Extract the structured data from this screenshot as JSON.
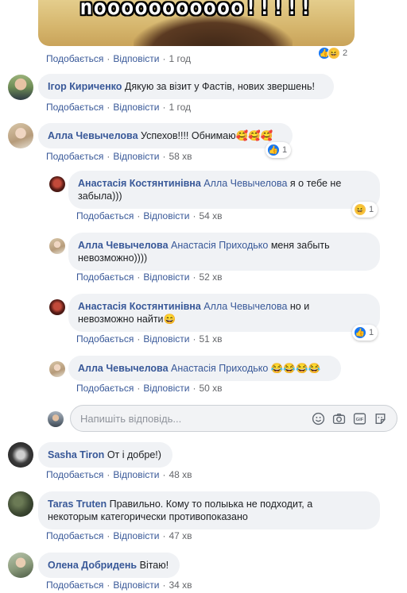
{
  "media": {
    "caption": "nooooooooooo!!!!!"
  },
  "labels": {
    "like": "Подобається",
    "reply": "Відповісти",
    "sep": "·"
  },
  "comments": [
    {
      "time": "1 год",
      "reaction_count": "2"
    },
    {
      "author": "Ігор Кириченко",
      "text": "Дякую за візит у Фастів, нових звершень!",
      "time": "1 год"
    },
    {
      "author": "Алла Чевычелова",
      "text": "Успехов!!!! Обнимаю🥰🥰🥰",
      "time": "58 хв",
      "reaction_count": "1"
    },
    {
      "author": "Анастасія Костянтинівна",
      "mention": "Алла Чевычелова",
      "text_line1": "я о тебе не",
      "text_line2": "забыла)))",
      "time": "54 хв",
      "reaction_count": "1"
    },
    {
      "author": "Алла Чевычелова",
      "mention": "Анастасія Приходько",
      "text_line1": "меня забыть",
      "text_line2": "невозможно))))",
      "time": "52 хв"
    },
    {
      "author": "Анастасія Костянтинівна",
      "mention": "Алла Чевычелова",
      "text_line1": "но и",
      "text_line2": "невозможно найти😄",
      "time": "51 хв",
      "reaction_count": "1"
    },
    {
      "author": "Алла Чевычелова",
      "mention": "Анастасія Приходько",
      "text": "😂😂😂😂",
      "time": "50 хв"
    },
    {
      "author": "Sasha Tiron",
      "text": "От і добре!)",
      "time": "48 хв"
    },
    {
      "author": "Taras Truten",
      "text_line1": "Правильно. Кому то полыька не подходит, а",
      "text_line2": "некоторым категорически противопоказано",
      "time": "47 хв"
    },
    {
      "author": "Олена Добридень",
      "text": "Вітаю!",
      "time": "34 хв"
    }
  ],
  "composer": {
    "placeholder": "Напишіть відповідь..."
  },
  "icons": [
    "emoji-icon",
    "camera-icon",
    "gif-icon",
    "sticker-icon",
    "like-reaction-icon",
    "haha-reaction-icon"
  ]
}
